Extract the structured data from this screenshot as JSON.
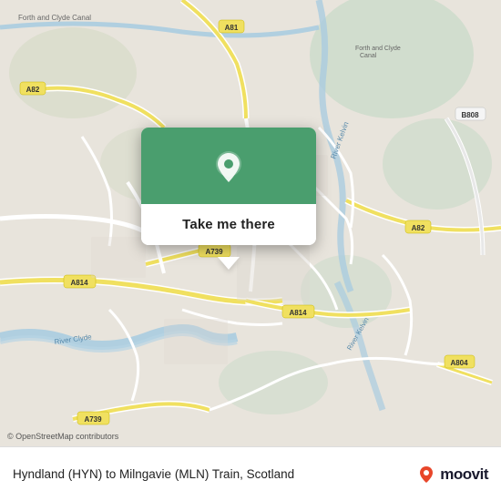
{
  "map": {
    "alt": "Street map of Glasgow area showing Hyndland to Milngavie route"
  },
  "popup": {
    "button_label": "Take me there"
  },
  "bottom_bar": {
    "route_text": "Hyndland (HYN) to Milngavie (MLN) Train, Scotland",
    "copyright": "© OpenStreetMap contributors"
  },
  "moovit": {
    "label": "moovit"
  },
  "colors": {
    "green": "#4a9e6e",
    "road_yellow": "#f5e66e",
    "road_white": "#ffffff",
    "water_blue": "#b8d8e8",
    "park_green": "#c8dfc8",
    "moovit_red": "#e8462a"
  }
}
